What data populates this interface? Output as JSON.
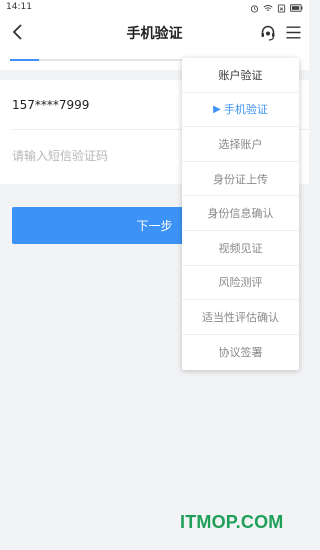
{
  "status_bar": {
    "time": "14:11",
    "icons": [
      "alarm-icon",
      "wifi-icon",
      "sim-icon",
      "battery-icon"
    ]
  },
  "nav": {
    "title": "手机验证",
    "back_icon": "chevron-left-icon",
    "service_icon": "customer-service-icon",
    "menu_icon": "menu-icon"
  },
  "progress": {
    "fraction": 0.1,
    "color": "#3d93f5"
  },
  "form": {
    "phone": "157****7999",
    "code_value": "",
    "code_placeholder": "请输入短信验证码"
  },
  "next_button": {
    "label": "下一步",
    "color": "#3d93f5"
  },
  "dropdown": {
    "items": [
      {
        "label": "账户验证",
        "state": "done"
      },
      {
        "label": "手机验证",
        "state": "current",
        "marker": "▶"
      },
      {
        "label": "选择账户",
        "state": "pending"
      },
      {
        "label": "身份证上传",
        "state": "pending"
      },
      {
        "label": "身份信息确认",
        "state": "pending"
      },
      {
        "label": "视频见证",
        "state": "pending"
      },
      {
        "label": "风险测评",
        "state": "pending"
      },
      {
        "label": "适当性评估确认",
        "state": "pending"
      },
      {
        "label": "协议签署",
        "state": "pending"
      }
    ]
  },
  "watermark": {
    "text": "ITMOP.COM",
    "color": "#1fa05a"
  }
}
